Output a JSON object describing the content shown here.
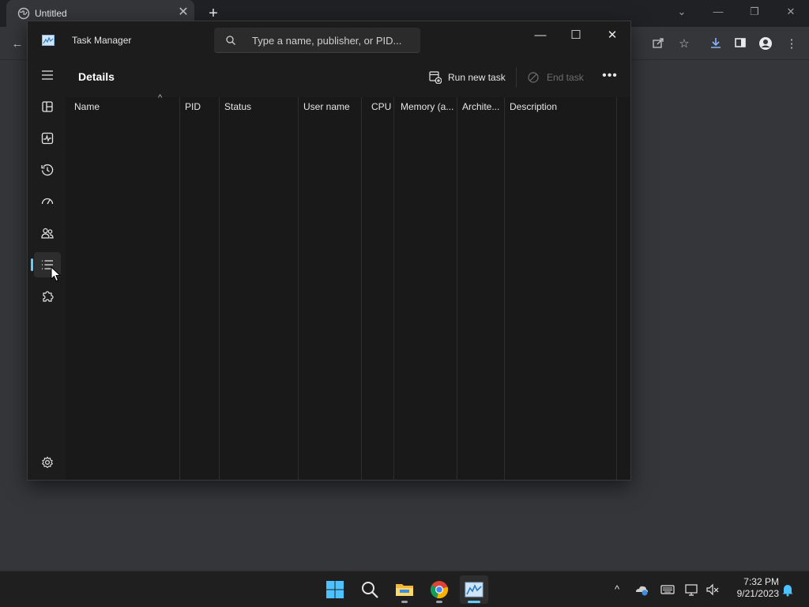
{
  "browser": {
    "tab_title": "Untitled",
    "tab_close": "✕",
    "new_tab": "+"
  },
  "task_manager": {
    "app_title": "Task Manager",
    "search_placeholder": "Type a name, publisher, or PID...",
    "window_controls": {
      "minimize": "—",
      "maximize": "☐",
      "close": "✕"
    },
    "page_title": "Details",
    "commands": {
      "run_new_task": "Run new task",
      "end_task": "End task",
      "more": "•••"
    },
    "columns": [
      {
        "label": "Name"
      },
      {
        "label": "PID"
      },
      {
        "label": "Status"
      },
      {
        "label": "User name"
      },
      {
        "label": "CPU"
      },
      {
        "label": "Memory (a..."
      },
      {
        "label": "Archite..."
      },
      {
        "label": "Description"
      }
    ],
    "sort_indicator": "^",
    "nav_items": [
      {
        "name": "hamburger-menu",
        "icon": "menu-icon"
      },
      {
        "name": "processes",
        "icon": "processes-icon"
      },
      {
        "name": "performance",
        "icon": "performance-icon"
      },
      {
        "name": "app-history",
        "icon": "history-icon"
      },
      {
        "name": "startup-apps",
        "icon": "speedometer-icon"
      },
      {
        "name": "users",
        "icon": "users-icon"
      },
      {
        "name": "details",
        "icon": "list-icon",
        "active": true
      },
      {
        "name": "services",
        "icon": "puzzle-icon"
      },
      {
        "name": "settings",
        "icon": "gear-icon"
      }
    ]
  },
  "taskbar": {
    "time": "7:32 PM",
    "date": "9/21/2023",
    "pinned": [
      "start-button",
      "search-button",
      "file-explorer",
      "chrome",
      "task-manager"
    ]
  },
  "colors": {
    "accent": "#60cdff",
    "window_bg": "#1c1c1c",
    "browser_bg": "#35363a"
  }
}
